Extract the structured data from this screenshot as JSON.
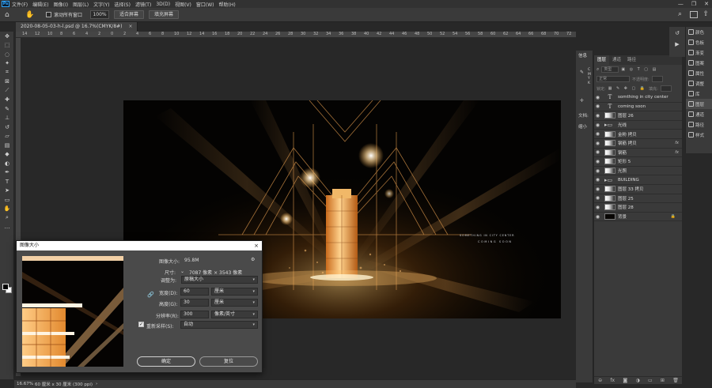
{
  "app": {
    "logo": "Ps",
    "menus": [
      "文件(F)",
      "编辑(E)",
      "图像(I)",
      "图层(L)",
      "文字(Y)",
      "选择(S)",
      "滤镜(T)",
      "3D(D)",
      "视图(V)",
      "窗口(W)",
      "帮助(H)"
    ],
    "window_controls": [
      "—",
      "❐",
      "✕"
    ]
  },
  "options": {
    "scroll_all_label": "滚动所有窗口",
    "zoom_value": "100%",
    "fit_screen_label": "适合屏幕",
    "fill_screen_label": "填充屏幕"
  },
  "document": {
    "tab_title": "2020-08-05-03-h-l.psd @ 16.7%(CMYK/8#)",
    "tab_close": "×",
    "ruler_ticks": [
      "14",
      "12",
      "10",
      "8",
      "6",
      "4",
      "2",
      "0",
      "2",
      "4",
      "6",
      "8",
      "10",
      "12",
      "14",
      "16",
      "18",
      "20",
      "22",
      "24",
      "26",
      "28",
      "30",
      "32",
      "34",
      "36",
      "38",
      "40",
      "42",
      "44",
      "46",
      "48",
      "50",
      "52",
      "54",
      "56",
      "58",
      "60",
      "62",
      "64",
      "66",
      "68",
      "70",
      "72"
    ],
    "artwork_caption_1": "SOMETHING IN CITY CENTER",
    "artwork_caption_2": "COMING SOON"
  },
  "dialog": {
    "title": "图像大小",
    "close": "×",
    "image_size_label": "图像大小:",
    "image_size_value": "95.8M",
    "dimensions_label": "尺寸:",
    "dimensions_value": "7087 像素 × 3543 像素",
    "fit_to_label": "调整为:",
    "fit_to_value": "原稿大小",
    "width_label": "宽度(D):",
    "width_value": "60",
    "width_unit": "厘米",
    "height_label": "高度(G):",
    "height_value": "30",
    "height_unit": "厘米",
    "resolution_label": "分辨率(R):",
    "resolution_value": "300",
    "resolution_unit": "像素/英寸",
    "resample_label": "重新采样(S):",
    "resample_value": "自动",
    "ok_label": "确定",
    "reset_label": "复位"
  },
  "info_panel": {
    "title": "信息",
    "letters": [
      "C",
      "M",
      "Y",
      "K"
    ],
    "doc_label": "文档:",
    "small_label": "缩小"
  },
  "layers_panel": {
    "tabs": [
      "图层",
      "通道",
      "路径"
    ],
    "filter_placeholder": "类型",
    "blend_mode": "正常",
    "opacity_label": "不透明度:",
    "lock_label": "锁定:",
    "fill_label": "填充:",
    "layers": [
      {
        "name": "somthing in city center",
        "kind": "text"
      },
      {
        "name": "coming soon",
        "kind": "text"
      },
      {
        "name": "图层 26",
        "kind": "light"
      },
      {
        "name": "光线",
        "kind": "folder"
      },
      {
        "name": "金粉 拷贝",
        "kind": "light"
      },
      {
        "name": "钢筋 拷贝",
        "kind": "light",
        "fx": "fx"
      },
      {
        "name": "钢筋",
        "kind": "light",
        "fx": "fx"
      },
      {
        "name": "矩形 5",
        "kind": "light"
      },
      {
        "name": "光照",
        "kind": "light"
      },
      {
        "name": "BUILDING",
        "kind": "folder"
      },
      {
        "name": "图层 33 拷贝",
        "kind": "light"
      },
      {
        "name": "图层 25",
        "kind": "light"
      },
      {
        "name": "图层 28",
        "kind": "light"
      },
      {
        "name": "背景",
        "kind": "dark",
        "lock": "🔒"
      }
    ]
  },
  "right_dock": {
    "items": [
      "颜色",
      "色板",
      "渐变",
      "图案",
      "属性",
      "调整",
      "库",
      "图层",
      "通道",
      "路径",
      "样式"
    ]
  },
  "status": {
    "zoom": "16.67%",
    "doc_info": "60 厘米 x 30 厘米 (300 ppi)",
    "caret": "›"
  },
  "colors": {
    "accent_gold": "#e7a354",
    "canvas_bg": "#282828",
    "panel_bg": "#3a3a3a"
  }
}
